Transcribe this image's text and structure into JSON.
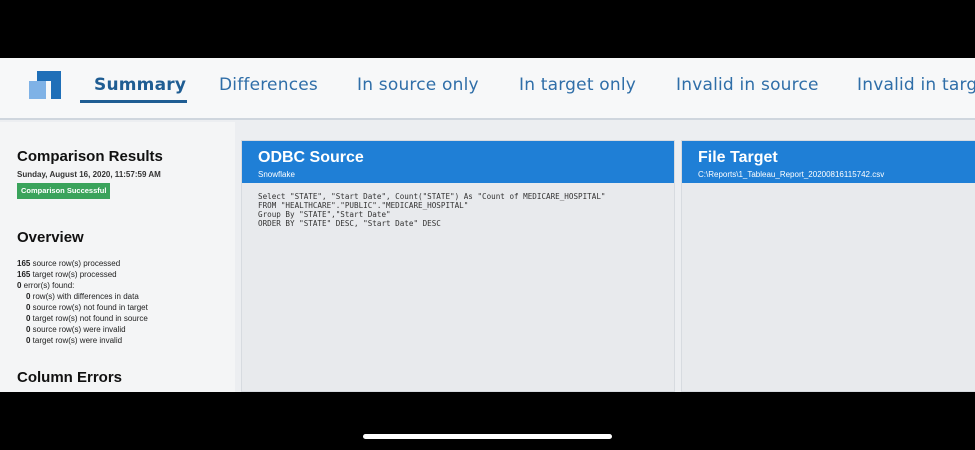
{
  "tabs": [
    {
      "label": "Summary",
      "active": true
    },
    {
      "label": "Differences"
    },
    {
      "label": "In source only"
    },
    {
      "label": "In target only"
    },
    {
      "label": "Invalid in source"
    },
    {
      "label": "Invalid in targe"
    }
  ],
  "summary": {
    "heading": "Comparison Results",
    "date": "Sunday, August 16, 2020, 11:57:59 AM",
    "status_badge": "Comparison Successful",
    "overview_heading": "Overview",
    "stats": [
      {
        "count": "165",
        "text": " source row(s) processed",
        "indent": false
      },
      {
        "count": "165",
        "text": " target row(s) processed",
        "indent": false
      },
      {
        "count": "0",
        "text": " error(s) found:",
        "indent": false
      },
      {
        "count": "0",
        "text": " row(s) with differences in data",
        "indent": true
      },
      {
        "count": "0",
        "text": " source row(s) not found in target",
        "indent": true
      },
      {
        "count": "0",
        "text": " target row(s) not found in source",
        "indent": true
      },
      {
        "count": "0",
        "text": " source row(s) were invalid",
        "indent": true
      },
      {
        "count": "0",
        "text": " target row(s) were invalid",
        "indent": true
      }
    ],
    "column_errors_heading": "Column Errors"
  },
  "source_panel": {
    "title": "ODBC Source",
    "subtitle": "Snowflake",
    "sql": "Select \"STATE\", \"Start Date\", Count(\"STATE\") As \"Count of MEDICARE_HOSPITAL\"\nFROM \"HEALTHCARE\".\"PUBLIC\".\"MEDICARE_HOSPITAL\"\nGroup By \"STATE\",\"Start Date\"\nORDER BY \"STATE\" DESC, \"Start Date\" DESC"
  },
  "target_panel": {
    "title": "File Target",
    "subtitle": "C:\\Reports\\1_Tableau_Report_20200816115742.csv"
  },
  "colors": {
    "panel_header": "#1f7fd6",
    "tab_text": "#2f6ea8",
    "badge": "#3aa35b"
  }
}
